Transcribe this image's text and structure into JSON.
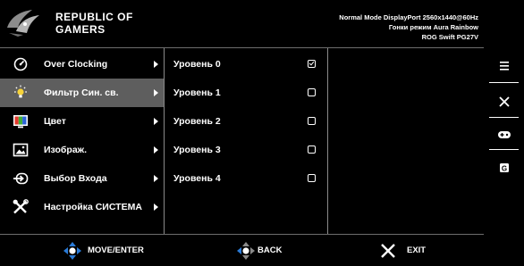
{
  "header": {
    "brand_line1": "REPUBLIC OF",
    "brand_line2": "GAMERS",
    "status_line1": "Normal Mode DisplayPort 2560x1440@60Hz",
    "status_line2": "Гонки режим Aura Rainbow",
    "status_line3": "ROG Swift PG27V"
  },
  "main_menu": [
    {
      "label": "Over Clocking",
      "icon": "speedometer-icon",
      "selected": false
    },
    {
      "label": "Фильтр Син. св.",
      "icon": "light-bulb-icon",
      "selected": true
    },
    {
      "label": "Цвет",
      "icon": "color-palette-icon",
      "selected": false
    },
    {
      "label": "Изображ.",
      "icon": "image-icon",
      "selected": false
    },
    {
      "label": "Выбор Входа",
      "icon": "input-select-icon",
      "selected": false
    },
    {
      "label": "Настройка СИСТЕМА",
      "icon": "wrench-tools-icon",
      "selected": false
    }
  ],
  "submenu": [
    {
      "label": "Уровень 0",
      "checked": true
    },
    {
      "label": "Уровень 1",
      "checked": false
    },
    {
      "label": "Уровень 2",
      "checked": false
    },
    {
      "label": "Уровень 3",
      "checked": false
    },
    {
      "label": "Уровень 4",
      "checked": false
    }
  ],
  "footer": {
    "move_enter": "MOVE/ENTER",
    "back": "BACK",
    "exit": "EXIT"
  },
  "rail": [
    "menu-icon",
    "close-icon",
    "gamepad-icon",
    "gamevisual-icon"
  ],
  "colors": {
    "background": "#000000",
    "selected_row": "#5e5e5e",
    "accent_blue": "#2a7bd8"
  }
}
